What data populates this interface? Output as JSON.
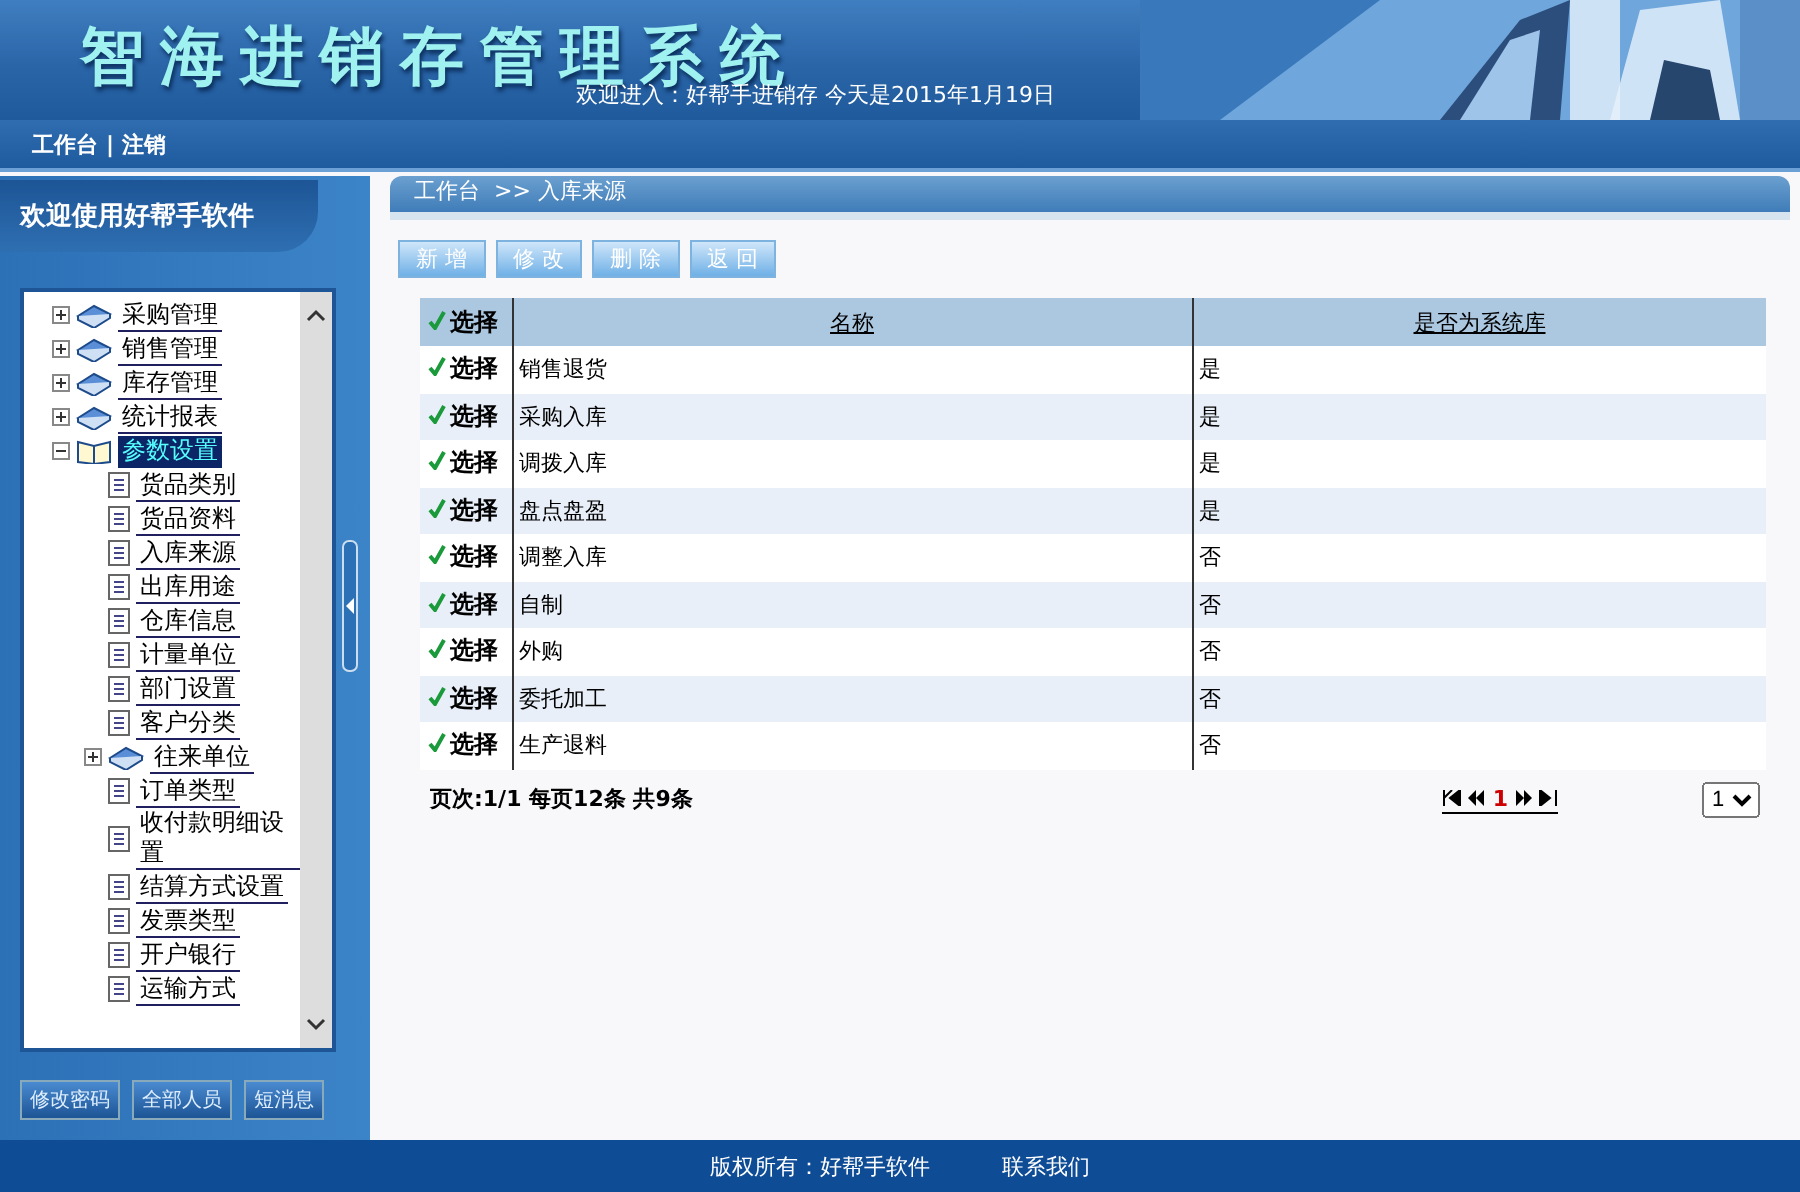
{
  "header": {
    "title": "智海进销存管理系统",
    "subtitle": "欢迎进入：好帮手进销存 今天是2015年1月19日"
  },
  "nav": {
    "links": [
      "工作台",
      "注销"
    ],
    "separator": "|"
  },
  "sidebar": {
    "title": "欢迎使用好帮手软件",
    "tree": [
      {
        "label": "采购管理",
        "kind": "folder",
        "expanded": false,
        "selected": false
      },
      {
        "label": "销售管理",
        "kind": "folder",
        "expanded": false,
        "selected": false
      },
      {
        "label": "库存管理",
        "kind": "folder",
        "expanded": false,
        "selected": false
      },
      {
        "label": "统计报表",
        "kind": "folder",
        "expanded": false,
        "selected": false
      },
      {
        "label": "参数设置",
        "kind": "folder",
        "expanded": true,
        "selected": true,
        "children": [
          {
            "label": "货品类别",
            "selected": false
          },
          {
            "label": "货品资料",
            "selected": false
          },
          {
            "label": "入库来源",
            "selected": false
          },
          {
            "label": "出库用途",
            "selected": false
          },
          {
            "label": "仓库信息",
            "selected": false
          },
          {
            "label": "计量单位",
            "selected": false
          },
          {
            "label": "部门设置",
            "selected": false
          },
          {
            "label": "客户分类",
            "selected": false
          },
          {
            "label": "往来单位",
            "kind": "folder",
            "expanded": false,
            "selected": false
          },
          {
            "label": "订单类型",
            "selected": false
          },
          {
            "label": "收付款明细设置",
            "selected": false
          },
          {
            "label": "结算方式设置",
            "selected": false
          },
          {
            "label": "发票类型",
            "selected": false
          },
          {
            "label": "开户银行",
            "selected": false
          },
          {
            "label": "运输方式",
            "selected": false
          }
        ]
      }
    ],
    "buttons": [
      "修改密码",
      "全部人员",
      "短消息"
    ]
  },
  "breadcrumb": "工作台  >> 入库来源",
  "toolbar": [
    "新 增",
    "修 改",
    "删 除",
    "返 回"
  ],
  "table": {
    "select_header": "选择",
    "columns": [
      "名称",
      "是否为系统库"
    ],
    "rows": [
      {
        "select": "选择",
        "name": "销售退货",
        "system": "是"
      },
      {
        "select": "选择",
        "name": "采购入库",
        "system": "是"
      },
      {
        "select": "选择",
        "name": "调拨入库",
        "system": "是"
      },
      {
        "select": "选择",
        "name": "盘点盘盈",
        "system": "是"
      },
      {
        "select": "选择",
        "name": "调整入库",
        "system": "否"
      },
      {
        "select": "选择",
        "name": "自制",
        "system": "否"
      },
      {
        "select": "选择",
        "name": "外购",
        "system": "否"
      },
      {
        "select": "选择",
        "name": "委托加工",
        "system": "否"
      },
      {
        "select": "选择",
        "name": "生产退料",
        "system": "否"
      }
    ]
  },
  "pagination": {
    "summary": "页次:1/1 每页12条 共9条",
    "current": "1",
    "page_select": "1"
  },
  "footer": {
    "copyright": "版权所有：好帮手软件",
    "contact": "联系我们"
  }
}
